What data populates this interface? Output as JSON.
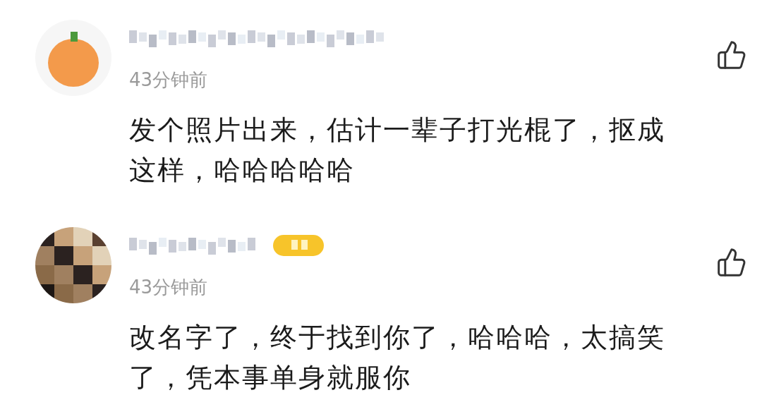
{
  "comments": [
    {
      "avatar": {
        "kind": "fruit"
      },
      "badge": false,
      "time": "43分钟前",
      "text": "发个照片出来，估计一辈子打光棍了，抠成这样，哈哈哈哈哈"
    },
    {
      "badge": true,
      "time": "43分钟前",
      "text": "改名字了，终于找到你了，哈哈哈，太搞笑了，凭本事单身就服你"
    }
  ]
}
